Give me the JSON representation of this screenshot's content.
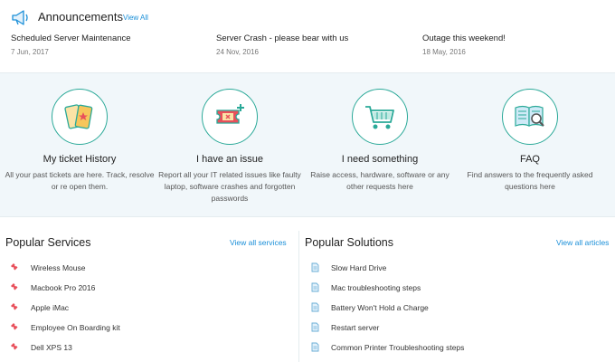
{
  "announcements": {
    "title": "Announcements",
    "view_all": "View All",
    "items": [
      {
        "title": "Scheduled Server Maintenance",
        "date": "7 Jun, 2017"
      },
      {
        "title": "Server Crash - please bear with us",
        "date": "24 Nov, 2016"
      },
      {
        "title": "Outage this weekend!",
        "date": "18 May, 2016"
      }
    ]
  },
  "actions": [
    {
      "icon": "tickets-icon",
      "title": "My ticket History",
      "desc": "All your past tickets are here. Track, resolve or re open them."
    },
    {
      "icon": "ticket-plus-icon",
      "title": "I have an issue",
      "desc": "Report all your IT related issues like faulty laptop, software crashes and forgotten passwords"
    },
    {
      "icon": "shopping-cart-icon",
      "title": "I need something",
      "desc": "Raise access, hardware, software or any other requests here"
    },
    {
      "icon": "book-search-icon",
      "title": "FAQ",
      "desc": "Find answers to the frequently asked questions here"
    }
  ],
  "popular_services": {
    "title": "Popular Services",
    "view_all": "View all services",
    "items": [
      "Wireless Mouse",
      "Macbook Pro 2016",
      "Apple iMac",
      "Employee On Boarding kit",
      "Dell XPS 13"
    ]
  },
  "popular_solutions": {
    "title": "Popular Solutions",
    "view_all": "View all articles",
    "items": [
      "Slow Hard Drive",
      "Mac troubleshooting steps",
      "Battery Won't Hold a Charge",
      "Restart server",
      "Common Printer Troubleshooting steps"
    ]
  },
  "colors": {
    "accent": "#1a8fd8",
    "teal": "#2aa998",
    "band_bg": "#f1f7fa",
    "ticket_red": "#e8505b"
  }
}
